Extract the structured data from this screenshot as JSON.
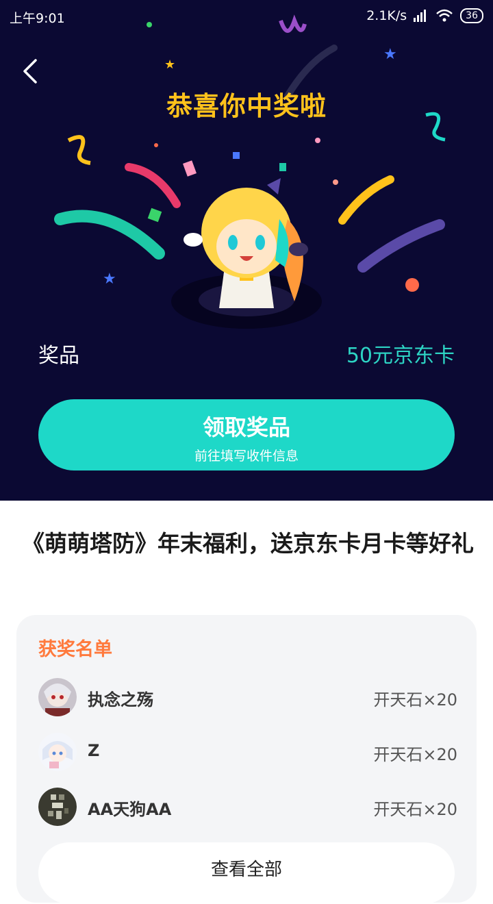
{
  "status": {
    "time": "上午9:01",
    "speed": "2.1K/s",
    "battery": "36"
  },
  "header": {
    "title": "恭喜你中奖啦"
  },
  "prize": {
    "label": "奖品",
    "value": "50元京东卡"
  },
  "claim": {
    "title": "领取奖品",
    "subtitle": "前往填写收件信息"
  },
  "event": {
    "title": "《萌萌塔防》年末福利，送京东卡月卡等好礼"
  },
  "winners": {
    "heading": "获奖名单",
    "items": [
      {
        "name": "执念之殇",
        "prize": "开天石×20"
      },
      {
        "name": "Z",
        "prize": "开天石×20"
      },
      {
        "name": "AA天狗AA",
        "prize": "开天石×20"
      }
    ],
    "view_all": "查看全部"
  },
  "colors": {
    "hero_bg": "#0b0933",
    "accent_teal": "#1ed8c8",
    "title_gold": "#ffc21b",
    "heading_orange": "#ff7a3d"
  },
  "icons": [
    "back-icon",
    "signal-icon",
    "wifi-icon",
    "battery-icon"
  ]
}
